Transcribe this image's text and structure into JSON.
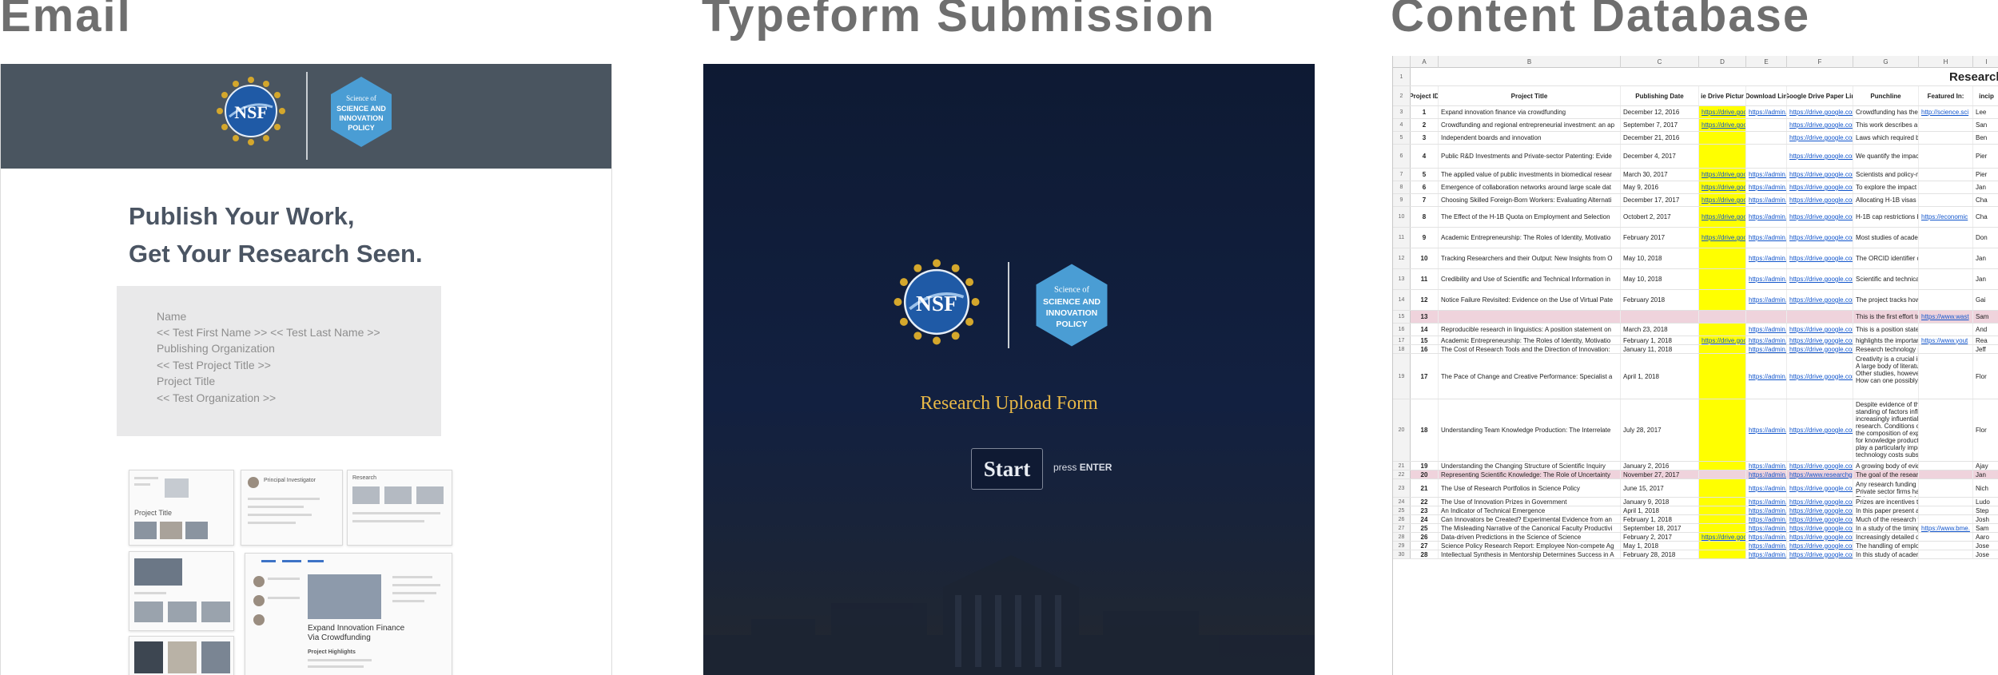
{
  "panels": {
    "email_title": "Email",
    "typeform_title": "Typeform Submission",
    "database_title": "Content Database"
  },
  "colors": {
    "email_header_bg": "#4a5560",
    "typeform_bg": "#122040",
    "typeform_accent": "#e8b847",
    "sheet_highlight_yellow": "#ffff00",
    "sheet_highlight_pink": "#efd3dc",
    "link_blue": "#1155cc"
  },
  "logos": {
    "nsf_text": "NSF",
    "ssip_lines": [
      "Science of",
      "SCIENCE AND",
      "INNOVATION",
      "POLICY"
    ]
  },
  "email": {
    "headline_line1": "Publish Your Work,",
    "headline_line2": "Get Your Research Seen.",
    "form_lines": [
      "Name",
      "<< Test First Name >> << Test Last Name >>",
      "Publishing Organization",
      "<< Test Project Title >>",
      "Project Title",
      "<< Test Organization >>"
    ],
    "preview_text": {
      "project_title": "Project Title",
      "principal_investigator": "Principal Investigator",
      "research": "Research",
      "expand_title_line1": "Expand Innovation Finance",
      "expand_title_line2": "Via Crowdfunding",
      "project_highlights": "Project Highlights"
    }
  },
  "typeform": {
    "form_title": "Research Upload Form",
    "start_label": "Start",
    "hint_prefix": "press",
    "hint_key": "ENTER"
  },
  "database": {
    "column_letters": [
      "A",
      "B",
      "C",
      "D",
      "E",
      "F",
      "G",
      "H",
      "I"
    ],
    "sheet_title": "Research Proj",
    "headers": [
      "Project ID",
      "Project Title",
      "Publishing Date",
      "ie Drive Pictur",
      "Download Lin",
      "Google Drive Paper Lin",
      "Punchline",
      "Featured In:",
      "incip"
    ],
    "rows": [
      {
        "n": "3",
        "id": "1",
        "title": "Expand innovation finance via crowdfunding",
        "date": "December 12, 2016",
        "drive": "https://drive.goo",
        "dl": "https://admin.",
        "paper": "https://drive.google.com",
        "punch": "Crowdfunding has the pc",
        "feat": "http://science.sci",
        "pi": "Lee"
      },
      {
        "n": "4",
        "id": "2",
        "title": "Crowdfunding and regional entrepreneurial investment: an ap",
        "date": "September 7, 2017",
        "drive": "https://drive.goo",
        "dl": "",
        "paper": "https://drive.google.com",
        "punch": "This work describes a d",
        "feat": "",
        "pi": "San"
      },
      {
        "n": "5",
        "id": "3",
        "title": "Independent boards and innovation",
        "date": "December 21, 2016",
        "drive": "",
        "dl": "",
        "paper": "https://drive.google.com",
        "punch": "Laws which required boa",
        "feat": "",
        "pi": "Ben"
      },
      {
        "n": "6",
        "id": "4",
        "title": "Public R&D Investments and Private-sector Patenting: Evide",
        "date": "December 4, 2017",
        "drive": "",
        "dl": "",
        "paper": "https://drive.google.com",
        "punch": "We quantify the impact c",
        "feat": "",
        "pi": "Pier"
      },
      {
        "n": "7",
        "id": "5",
        "title": "The applied value of public investments in biomedical resear",
        "date": "March 30, 2017",
        "drive": "https://drive.goo",
        "dl": "https://admin.",
        "paper": "https://drive.google.com",
        "punch": "Scientists and policy-ma",
        "feat": "",
        "pi": "Pier"
      },
      {
        "n": "8",
        "id": "6",
        "title": "Emergence of collaboration networks around large scale dat",
        "date": "May 9, 2016",
        "drive": "https://drive.goo",
        "dl": "https://admin.",
        "paper": "https://drive.google.com",
        "punch": "To explore the impact of",
        "feat": "",
        "pi": "Jan"
      },
      {
        "n": "9",
        "id": "7",
        "title": "Choosing Skilled Foreign-Born Workers: Evaluating Alternati",
        "date": "December 17, 2017",
        "drive": "https://drive.goo",
        "dl": "https://admin.",
        "paper": "https://drive.google.com",
        "punch": "Allocating H-1B visas ac",
        "feat": "",
        "pi": "Cha"
      },
      {
        "n": "10",
        "id": "8",
        "title": "The Effect of the H-1B Quota on Employment and Selection",
        "date": "Octobert 2, 2017",
        "drive": "https://drive.goo",
        "dl": "https://admin.",
        "paper": "https://drive.google.com",
        "punch": "H-1B cap restrictions be",
        "feat": "https://economic",
        "pi": "Cha"
      },
      {
        "n": "11",
        "id": "9",
        "title": "Academic Entrepreneurship: The Roles of Identity, Motivatio",
        "date": "February 2017",
        "drive": "https://drive.goo",
        "dl": "https://admin.",
        "paper": "https://drive.google.com",
        "punch": "Most studies of academi",
        "feat": "",
        "pi": "Don"
      },
      {
        "n": "12",
        "id": "10",
        "title": "Tracking Researchers and their Output: New Insights from O",
        "date": "May 10, 2018",
        "drive": "",
        "dl": "https://admin.",
        "paper": "https://drive.google.com",
        "punch": "The ORCID identifier ca",
        "feat": "",
        "pi": "Jan"
      },
      {
        "n": "13",
        "id": "11",
        "title": "Credibility and Use of Scientific and Technical Information in",
        "date": "May 10, 2018",
        "drive": "",
        "dl": "https://admin.",
        "paper": "https://drive.google.com",
        "punch": "Scientific and technical i",
        "feat": "",
        "pi": "Jan"
      },
      {
        "n": "14",
        "id": "12",
        "title": "Notice Failure Revisited: Evidence on the Use of Virtual Pate",
        "date": "February 2018",
        "drive": "",
        "dl": "https://admin.",
        "paper": "https://drive.google.com",
        "punch": "The project tracks how s",
        "feat": "",
        "pi": "Gai"
      },
      {
        "n": "15",
        "id": "13",
        "title": "",
        "date": "",
        "drive": "",
        "dl": "",
        "paper": "",
        "punch": "This is the first effort to",
        "feat": "https://www.wast",
        "pi": "Sam"
      },
      {
        "n": "16",
        "id": "14",
        "title": "Reproducible research in linguistics: A position statement on",
        "date": "March 23, 2018",
        "drive": "",
        "dl": "https://admin.",
        "paper": "https://drive.google.com",
        "punch": "This is a position statem",
        "feat": "",
        "pi": "And"
      },
      {
        "n": "17",
        "id": "15",
        "title": "Academic Entrepreneurship: The Roles of Identity, Motivatio",
        "date": "February 1, 2018",
        "drive": "https://drive.goo",
        "dl": "https://admin.",
        "paper": "https://drive.google.com",
        "punch": "highlights the importanc",
        "feat": "https://www.yout",
        "pi": "Rea"
      },
      {
        "n": "18",
        "id": "16",
        "title": "The Cost of Research Tools and the Direction of Innovation:",
        "date": "January 11, 2018",
        "drive": "",
        "dl": "https://admin.",
        "paper": "https://drive.google.com",
        "punch": "Research technology pla",
        "feat": "",
        "pi": "Jeff"
      },
      {
        "n": "19",
        "id": "17",
        "title": "The Pace of Change and Creative Performance: Specialist a",
        "date": "April 1, 2018",
        "drive": "",
        "dl": "https://admin.",
        "paper": "https://drive.google.com",
        "punch": "Creativity is a crucial ing\nA large body of literature\nOther studies, however,\nHow can one possibly re",
        "feat": "",
        "pi": "Flor"
      },
      {
        "n": "20",
        "id": "18",
        "title": "Understanding Team Knowledge Production: The Interrelate",
        "date": "July 28, 2017",
        "drive": "",
        "dl": "https://admin.",
        "paper": "https://drive.google.com",
        "punch": "Despite evidence of the\nstanding of factors influe\nincreasingly influential ro\nresearch. Conditions of s\nthe composition of exper\nfor knowledge productio\nplay a particularly import\ntechnology costs substit",
        "feat": "",
        "pi": "Flor"
      },
      {
        "n": "21",
        "id": "19",
        "title": "Understanding the Changing Structure of Scientific Inquiry",
        "date": "January 2, 2016",
        "drive": "",
        "dl": "https://admin.",
        "paper": "https://drive.google.com",
        "punch": "A growing body of evide",
        "feat": "",
        "pi": "Ajay"
      },
      {
        "n": "22",
        "id": "20",
        "title": "Representing Scientific Knowledge: The Role of Uncertainty",
        "date": "November 27, 2017",
        "drive": "",
        "dl": "https://admin.",
        "paper": "https://www.researchgat",
        "punch": "The goal of the research",
        "feat": "",
        "pi": "Jan"
      },
      {
        "n": "23",
        "id": "21",
        "title": "The Use of Research Portfolios in Science Policy",
        "date": "June 15, 2017",
        "drive": "",
        "dl": "https://admin.",
        "paper": "https://drive.google.com",
        "punch": "Any research funding an\nPrivate sector firms have\nThis report argues it is h",
        "feat": "",
        "pi": "Nich"
      },
      {
        "n": "24",
        "id": "22",
        "title": "The Use of Innovation Prizes in Government",
        "date": "January 9, 2018",
        "drive": "",
        "dl": "https://admin.",
        "paper": "https://drive.google.com",
        "punch": "Prizes are incentives tha",
        "feat": "",
        "pi": "Ludo"
      },
      {
        "n": "25",
        "id": "23",
        "title": "An Indicator of Technical Emergence",
        "date": "April 1, 2018",
        "drive": "",
        "dl": "https://admin.",
        "paper": "https://drive.google.com",
        "punch": "In this paper present a s",
        "feat": "",
        "pi": "Step"
      },
      {
        "n": "26",
        "id": "24",
        "title": "Can Innovators be Created? Experimental Evidence from an",
        "date": "February 1, 2018",
        "drive": "",
        "dl": "https://admin.",
        "paper": "https://drive.google.com",
        "punch": "Much of the research th",
        "feat": "",
        "pi": "Josh"
      },
      {
        "n": "27",
        "id": "25",
        "title": "The Misleading Narrative of the Canonical Faculty Productivi",
        "date": "September 18, 2017",
        "drive": "",
        "dl": "https://admin.",
        "paper": "https://drive.google.com",
        "punch": "In a study of the timing o",
        "feat": "https://www.bme.",
        "pi": "Sam"
      },
      {
        "n": "28",
        "id": "26",
        "title": "Data-driven Predictions in the Science of Science",
        "date": "February 2, 2017",
        "drive": "https://drive.goo",
        "dl": "https://admin.",
        "paper": "https://drive.google.com",
        "punch": "Increasingly detailed dat",
        "feat": "",
        "pi": "Aaro"
      },
      {
        "n": "29",
        "id": "27",
        "title": "Science Policy Research Report: Employee Non-compete Ag",
        "date": "May 1, 2018",
        "drive": "",
        "dl": "https://admin.",
        "paper": "https://drive.google.com",
        "punch": "The handling of employe",
        "feat": "",
        "pi": "Jose"
      },
      {
        "n": "30",
        "id": "28",
        "title": "Intellectual Synthesis in Mentorship Determines Success in A",
        "date": "February 28, 2018",
        "drive": "",
        "dl": "https://admin.",
        "paper": "https://drive.google.com",
        "punch": "In this study of academic",
        "feat": "",
        "pi": "Jose"
      }
    ]
  }
}
